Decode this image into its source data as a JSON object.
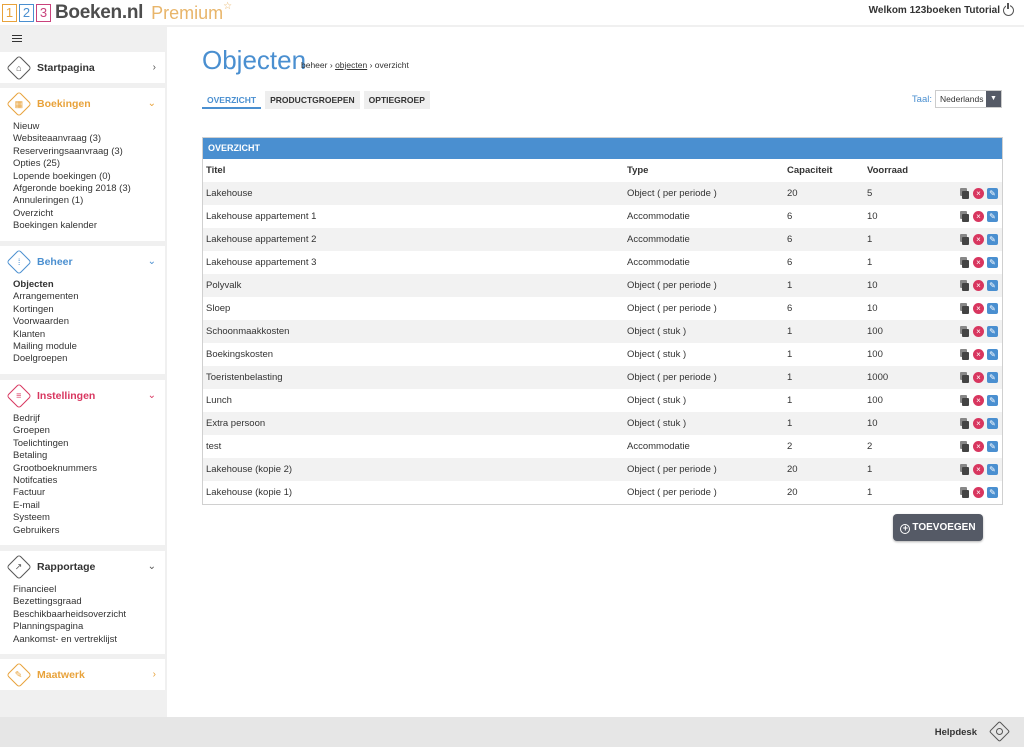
{
  "header": {
    "logo_digits": [
      "1",
      "2",
      "3"
    ],
    "logo_name": "Boeken.nl",
    "logo_premium": "Premium",
    "logo_star": "☆",
    "welcome": "Welkom 123boeken Tutorial"
  },
  "sidebar": {
    "panels": [
      {
        "title": "Startpagina",
        "icon": "house-icon",
        "arrow": "›",
        "items": []
      },
      {
        "title": "Boekingen",
        "icon": "calendar-icon",
        "arrow": "⌄",
        "items": [
          "Nieuw",
          "Websiteaanvraag (3)",
          "Reserveringsaanvraag (3)",
          "Opties (25)",
          "Lopende boekingen (0)",
          "Afgeronde boeking 2018 (3)",
          "Annuleringen (1)",
          "Overzicht",
          "Boekingen kalender"
        ]
      },
      {
        "title": "Beheer",
        "icon": "grid-icon",
        "arrow": "⌄",
        "items": [
          "Objecten",
          "Arrangementen",
          "Kortingen",
          "Voorwaarden",
          "Klanten",
          "Mailing module",
          "Doelgroepen"
        ]
      },
      {
        "title": "Instellingen",
        "icon": "sliders-icon",
        "arrow": "⌄",
        "items": [
          "Bedrijf",
          "Groepen",
          "Toelichtingen",
          "Betaling",
          "Grootboeknummers",
          "Notifcaties",
          "Factuur",
          "E-mail",
          "Systeem",
          "Gebruikers"
        ]
      },
      {
        "title": "Rapportage",
        "icon": "chart-icon",
        "arrow": "⌄",
        "items": [
          "Financieel",
          "Bezettingsgraad",
          "Beschikbaarheidsoverzicht",
          "Planningspagina",
          "Aankomst- en vertreklijst"
        ]
      },
      {
        "title": "Maatwerk",
        "icon": "tools-icon",
        "arrow": "›",
        "items": []
      }
    ]
  },
  "main": {
    "title": "Objecten",
    "breadcrumb": {
      "first": "beheer",
      "sep": "›",
      "link": "objecten",
      "last": "overzicht"
    },
    "tabs": [
      "OVERZICHT",
      "PRODUCTGROEPEN",
      "OPTIEGROEP"
    ],
    "taal_label": "Taal:",
    "taal_value": "Nederlands",
    "table_title": "OVERZICHT",
    "columns": [
      "Titel",
      "Type",
      "Capaciteit",
      "Voorraad"
    ],
    "rows": [
      [
        "Lakehouse",
        "Object ( per periode )",
        "20",
        "5"
      ],
      [
        "Lakehouse appartement 1",
        "Accommodatie",
        "6",
        "10"
      ],
      [
        "Lakehouse appartement 2",
        "Accommodatie",
        "6",
        "1"
      ],
      [
        "Lakehouse appartement 3",
        "Accommodatie",
        "6",
        "1"
      ],
      [
        "Polyvalk",
        "Object ( per periode )",
        "1",
        "10"
      ],
      [
        "Sloep",
        "Object ( per periode )",
        "6",
        "10"
      ],
      [
        "Schoonmaakkosten",
        "Object ( stuk )",
        "1",
        "100"
      ],
      [
        "Boekingskosten",
        "Object ( stuk )",
        "1",
        "100"
      ],
      [
        "Toeristenbelasting",
        "Object ( per periode )",
        "1",
        "1000"
      ],
      [
        "Lunch",
        "Object ( stuk )",
        "1",
        "100"
      ],
      [
        "Extra persoon",
        "Object ( stuk )",
        "1",
        "10"
      ],
      [
        "test",
        "Accommodatie",
        "2",
        "2"
      ],
      [
        "Lakehouse (kopie 2)",
        "Object ( per periode )",
        "20",
        "1"
      ],
      [
        "Lakehouse (kopie 1)",
        "Object ( per periode )",
        "20",
        "1"
      ]
    ],
    "add_button": "TOEVOEGEN"
  },
  "footer": {
    "helpdesk": "Helpdesk"
  }
}
